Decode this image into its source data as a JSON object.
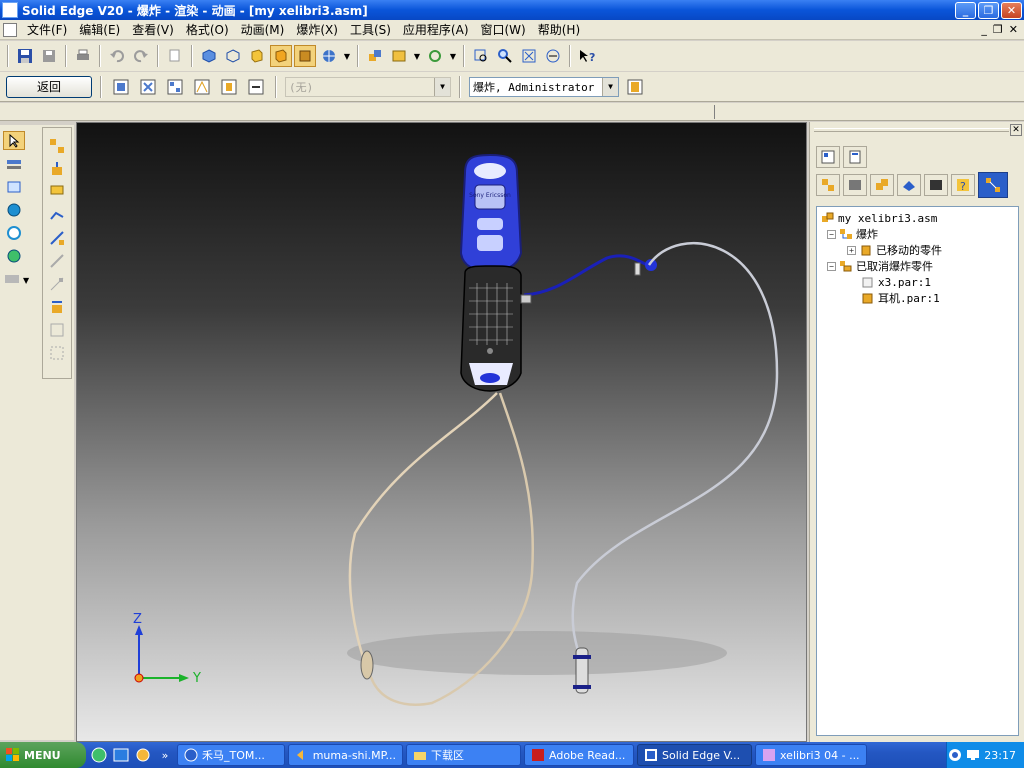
{
  "window": {
    "title": "Solid Edge V20 - 爆炸 - 渲染 - 动画 - [my xelibri3.asm]"
  },
  "menu": {
    "items": [
      "文件(F)",
      "编辑(E)",
      "查看(V)",
      "格式(O)",
      "动画(M)",
      "爆炸(X)",
      "工具(S)",
      "应用程序(A)",
      "窗口(W)",
      "帮助(H)"
    ]
  },
  "toolbar2": {
    "return_label": "返回",
    "style_combo": "(无)",
    "user_combo": "爆炸, Administrator"
  },
  "viewport": {
    "axis_z": "Z",
    "axis_y": "Y",
    "phone_brand": "Sony Ericsson"
  },
  "tree": {
    "root": "my xelibri3.asm",
    "explode": "爆炸",
    "moved_parts": "已移动的零件",
    "unexploded_parts": "已取消爆炸零件",
    "part1": "x3.par:1",
    "part2": "耳机.par:1"
  },
  "taskbar": {
    "start": "MENU",
    "overflow": "»",
    "tasks": [
      "禾马_TOM...",
      "muma-shi.MP...",
      "下载区",
      "Adobe Read...",
      "Solid Edge V...",
      "xelibri3 04 - ..."
    ],
    "clock": "23:17"
  },
  "colors": {
    "title_blue": "#0a55d9",
    "phone_blue": "#2333d8",
    "selected_tool": "#f3d27b"
  }
}
